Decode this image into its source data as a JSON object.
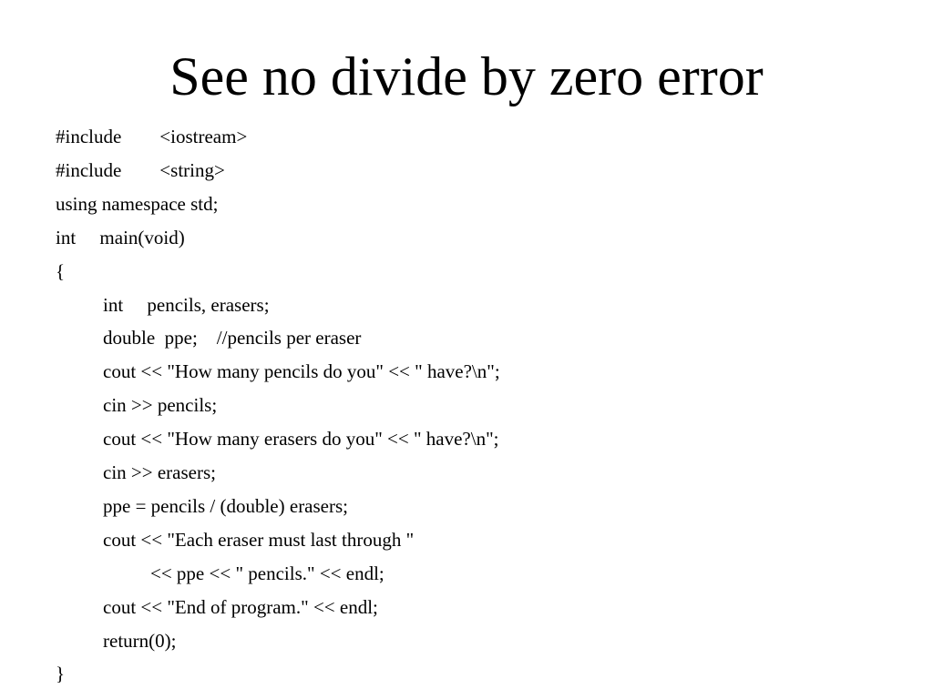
{
  "slide": {
    "title": "See no divide by zero error",
    "code_lines": [
      {
        "text": "#include        <iostream>",
        "indent": 0
      },
      {
        "text": "#include        <string>",
        "indent": 0
      },
      {
        "text": "using namespace std;",
        "indent": 0
      },
      {
        "text": "int     main(void)",
        "indent": 0
      },
      {
        "text": "{",
        "indent": 0
      },
      {
        "text": "int     pencils, erasers;",
        "indent": 1
      },
      {
        "text": "double  ppe;    //pencils per eraser",
        "indent": 1
      },
      {
        "text": "cout << \"How many pencils do you\" << \" have?\\n\";",
        "indent": 1
      },
      {
        "text": "cin >> pencils;",
        "indent": 1
      },
      {
        "text": "cout << \"How many erasers do you\" << \" have?\\n\";",
        "indent": 1
      },
      {
        "text": "cin >> erasers;",
        "indent": 1
      },
      {
        "text": "ppe = pencils / (double) erasers;",
        "indent": 1
      },
      {
        "text": "cout << \"Each eraser must last through \"",
        "indent": 1
      },
      {
        "text": "<< ppe << \" pencils.\" << endl;",
        "indent": 2
      },
      {
        "text": "cout << \"End of program.\" << endl;",
        "indent": 1
      },
      {
        "text": "return(0);",
        "indent": 1
      },
      {
        "text": "}",
        "indent": 0
      }
    ]
  }
}
